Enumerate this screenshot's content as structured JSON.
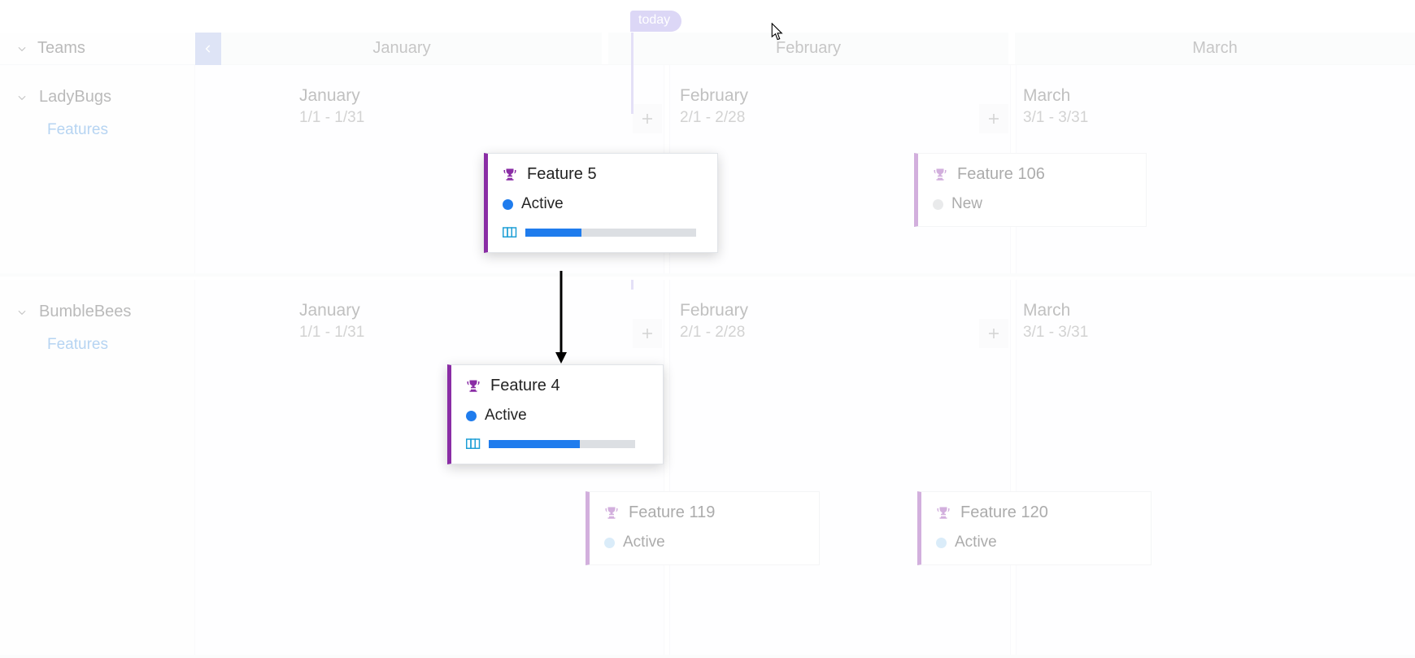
{
  "today_label": "today",
  "header": {
    "side_label": "Teams",
    "months": [
      "January",
      "February",
      "March"
    ]
  },
  "lanes": [
    {
      "name": "LadyBugs",
      "sub": "Features",
      "months": [
        {
          "name": "January",
          "range": "1/1 - 1/31"
        },
        {
          "name": "February",
          "range": "2/1 - 2/28"
        },
        {
          "name": "March",
          "range": "3/1 - 3/31"
        }
      ]
    },
    {
      "name": "BumbleBees",
      "sub": "Features",
      "months": [
        {
          "name": "January",
          "range": "1/1 - 1/31"
        },
        {
          "name": "February",
          "range": "2/1 - 2/28"
        },
        {
          "name": "March",
          "range": "3/1 - 3/31"
        }
      ]
    }
  ],
  "cards": {
    "f5": {
      "title": "Feature 5",
      "status": "Active",
      "progress_pct": 33
    },
    "f4": {
      "title": "Feature 4",
      "status": "Active",
      "progress_pct": 62
    },
    "f106": {
      "title": "Feature 106",
      "status": "New"
    },
    "f119": {
      "title": "Feature 119",
      "status": "Active"
    },
    "f120": {
      "title": "Feature 120",
      "status": "Active"
    }
  },
  "colors": {
    "accent_purple": "#8a2da5",
    "today_purple": "#a495e6",
    "blue": "#1f7ced",
    "link": "#3f8edc"
  }
}
